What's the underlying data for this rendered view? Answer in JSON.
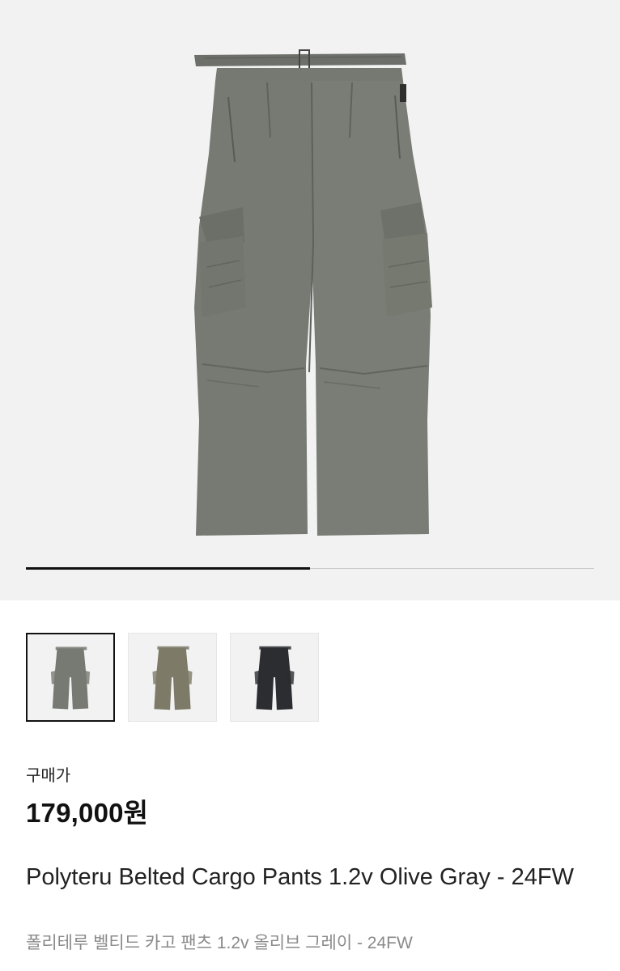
{
  "product": {
    "price_label": "구매가",
    "price": "179,000원",
    "name_en": "Polyteru Belted Cargo Pants 1.2v Olive Gray - 24FW",
    "name_ko": "폴리테루 벨티드 카고 팬츠 1.2v 올리브 그레이 - 24FW"
  },
  "gallery": {
    "image_count": 2,
    "current_index": 1,
    "progress_fraction": 0.5,
    "main_image": "cargo-pants-olive-gray-photo"
  },
  "thumbnails": [
    {
      "image": "cargo-pants-olive-gray",
      "selected": true,
      "color": "#777a72"
    },
    {
      "image": "cargo-pants-olive-khaki",
      "selected": false,
      "color": "#7d7b68"
    },
    {
      "image": "cargo-pants-black",
      "selected": false,
      "color": "#2b2d31"
    }
  ],
  "colors": {
    "gallery_bg": "#f2f2f2",
    "pants_olive_gray": "#777a72",
    "progress_active": "#111111",
    "progress_track": "#c8c8c8",
    "subtitle_gray": "#8a8a8a"
  }
}
